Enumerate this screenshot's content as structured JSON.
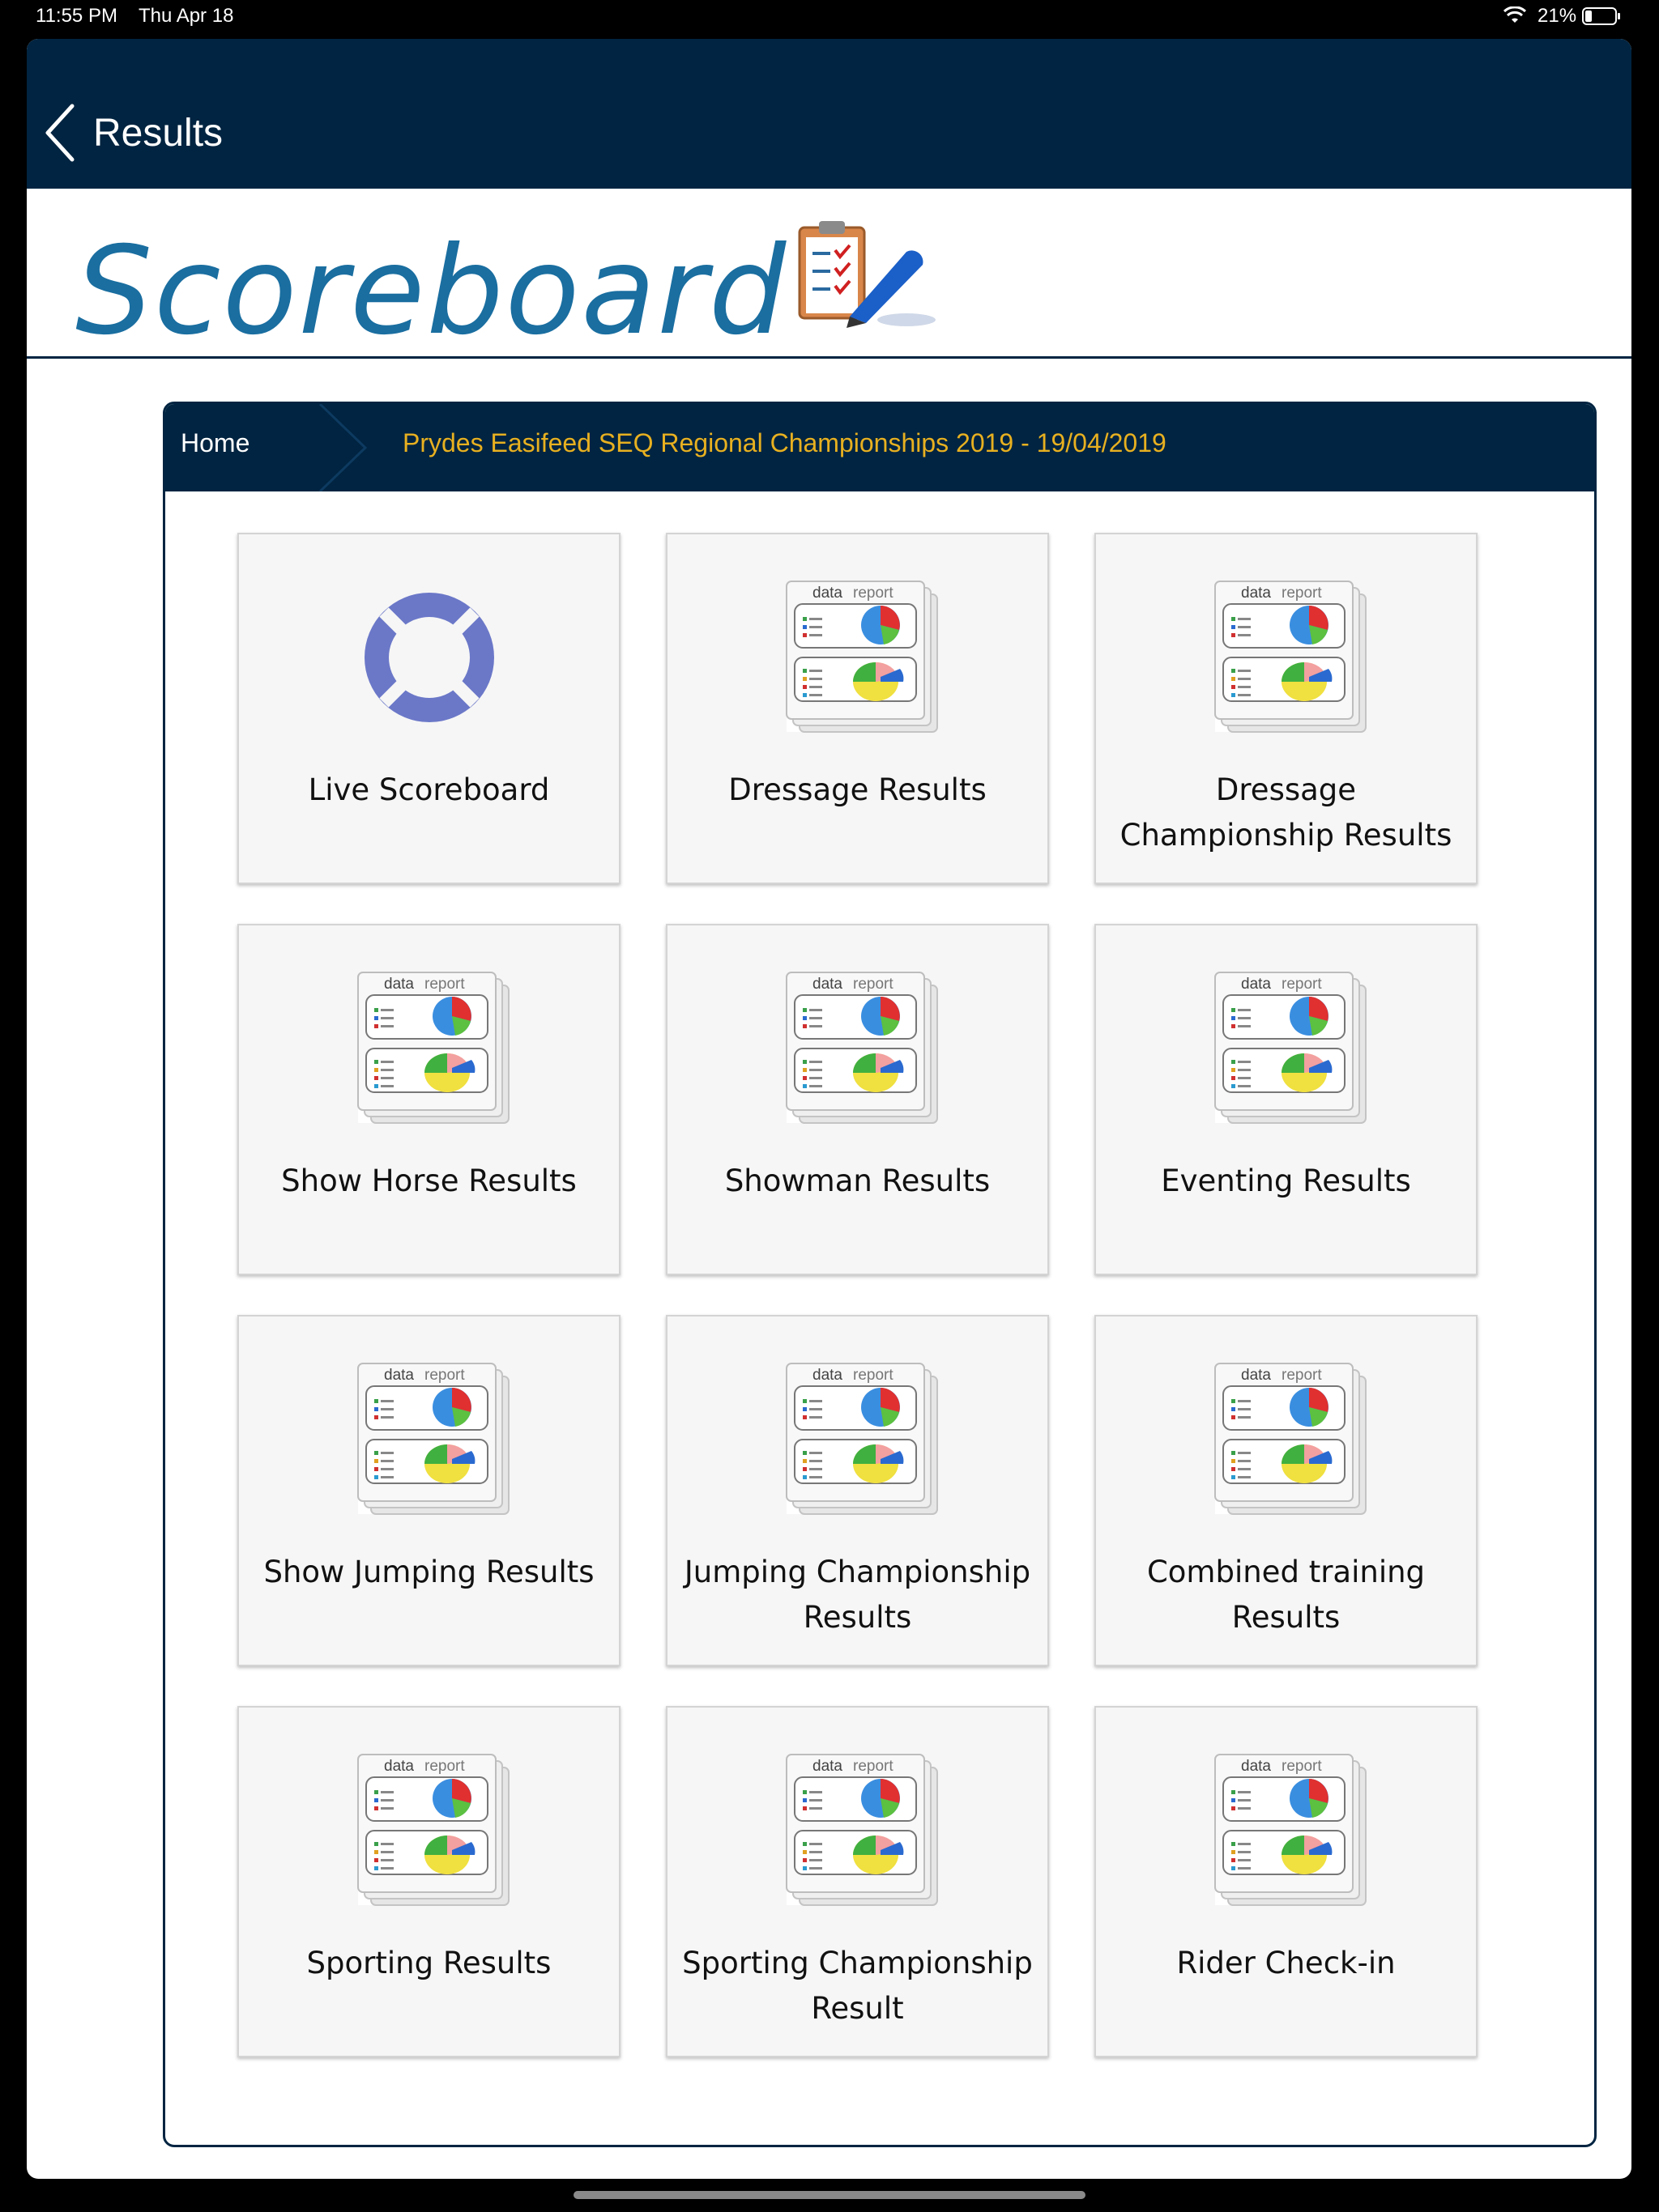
{
  "status_bar": {
    "time": "11:55 PM",
    "date": "Thu Apr 18",
    "battery": "21%"
  },
  "nav": {
    "back_label": "Results"
  },
  "brand": {
    "title": "Scoreboard",
    "icon": "clipboard-pen-icon",
    "color": "#1a6ea0"
  },
  "breadcrumb": {
    "home": "Home",
    "event": "Prydes Easifeed SEQ Regional Championships 2019 - 19/04/2019"
  },
  "tiles": [
    {
      "label": "Live Scoreboard",
      "icon": "lifebuoy-icon"
    },
    {
      "label": "Dressage Results",
      "icon": "data-report-icon"
    },
    {
      "label": "Dressage Championship Results",
      "icon": "data-report-icon"
    },
    {
      "label": "Show Horse Results",
      "icon": "data-report-icon"
    },
    {
      "label": "Showman Results",
      "icon": "data-report-icon"
    },
    {
      "label": "Eventing Results",
      "icon": "data-report-icon"
    },
    {
      "label": "Show Jumping Results",
      "icon": "data-report-icon"
    },
    {
      "label": "Jumping Championship Results",
      "icon": "data-report-icon"
    },
    {
      "label": "Combined training Results",
      "icon": "data-report-icon"
    },
    {
      "label": "Sporting Results",
      "icon": "data-report-icon"
    },
    {
      "label": "Sporting Championship Result",
      "icon": "data-report-icon"
    },
    {
      "label": "Rider Check-in",
      "icon": "data-report-icon"
    }
  ],
  "data_report_icon": {
    "word_a": "data",
    "word_b": "report"
  },
  "colors": {
    "nav_bg": "#002441",
    "accent": "#e8b020",
    "lifebuoy": "#6b78c8"
  }
}
